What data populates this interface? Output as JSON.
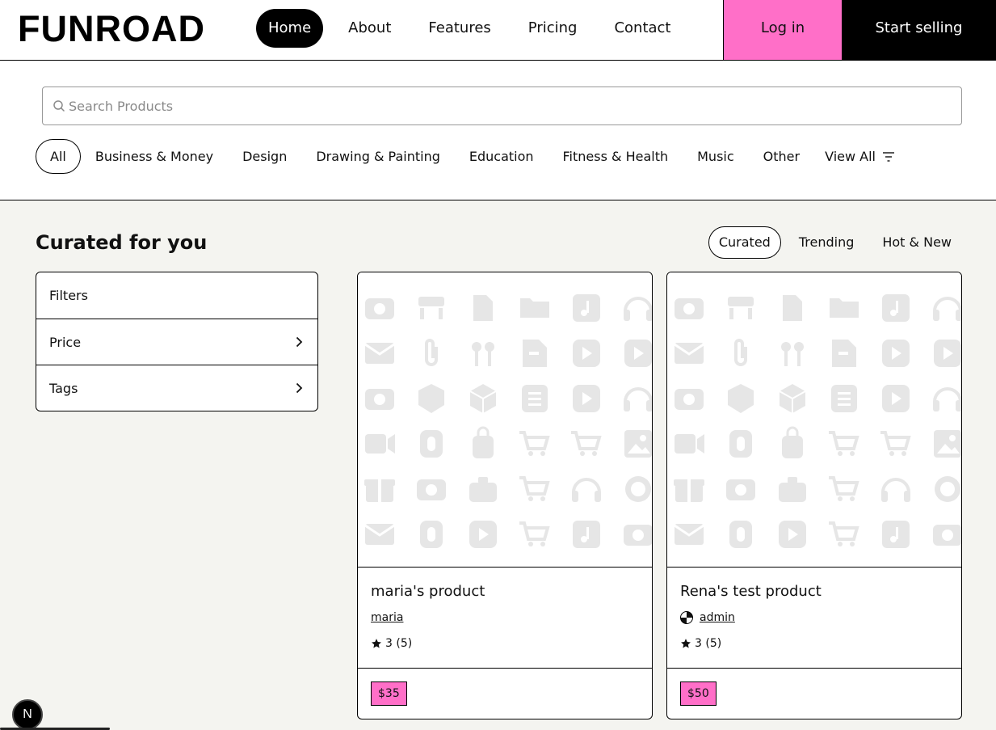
{
  "brand": {
    "logo": "FUNROAD",
    "accent_color": "#ff6fc8"
  },
  "nav": {
    "items": [
      {
        "label": "Home",
        "active": true
      },
      {
        "label": "About"
      },
      {
        "label": "Features"
      },
      {
        "label": "Pricing"
      },
      {
        "label": "Contact"
      }
    ],
    "login_label": "Log in",
    "start_selling_label": "Start selling"
  },
  "search": {
    "placeholder": "Search Products",
    "value": ""
  },
  "categories": {
    "items": [
      "All",
      "Business & Money",
      "Design",
      "Drawing & Painting",
      "Education",
      "Fitness & Health",
      "Music",
      "Other"
    ],
    "selected": "All",
    "view_all_label": "View All"
  },
  "main": {
    "title": "Curated for you",
    "tabs": [
      {
        "label": "Curated",
        "active": true
      },
      {
        "label": "Trending"
      },
      {
        "label": "Hot & New"
      }
    ]
  },
  "filters": {
    "heading": "Filters",
    "rows": [
      {
        "label": "Price"
      },
      {
        "label": "Tags"
      }
    ]
  },
  "products": [
    {
      "title": "maria's product",
      "author": "maria",
      "has_avatar": false,
      "rating": "3 (5)",
      "price": "$35"
    },
    {
      "title": "Rena's test product",
      "author": "admin",
      "has_avatar": true,
      "rating": "3 (5)",
      "price": "$50"
    }
  ],
  "dev_badge": {
    "label": "N"
  }
}
